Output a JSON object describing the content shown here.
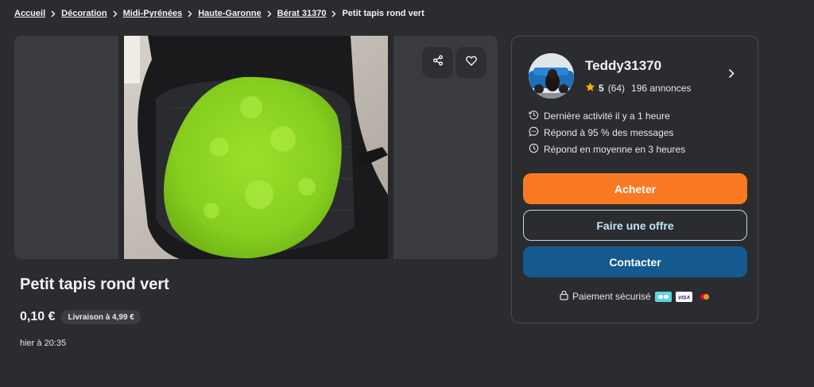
{
  "breadcrumb": {
    "items": [
      "Accueil",
      "Décoration",
      "Midi-Pyrénées",
      "Haute-Garonne",
      "Bérat 31370"
    ],
    "current": "Petit tapis rond vert"
  },
  "listing": {
    "title": "Petit tapis rond vert",
    "price": "0,10 €",
    "shipping": "Livraison à 4,99 €",
    "posted": "hier à 20:35"
  },
  "seller": {
    "name": "Teddy31370",
    "rating": "5",
    "rating_count": "(64)",
    "listings": "196 annonces",
    "last_activity": "Dernière activité il y a 1 heure",
    "response_rate": "Répond à 95 % des messages",
    "response_time": "Répond en moyenne en 3 heures"
  },
  "actions": {
    "buy": "Acheter",
    "offer": "Faire une offre",
    "contact": "Contacter"
  },
  "payment": {
    "label": "Paiement sécurisé"
  },
  "colors": {
    "background": "#2b2c30",
    "buy": "#f97a22",
    "contact": "#14598f",
    "offer_border": "#b9dbe6",
    "star": "#f5b400"
  },
  "icons": [
    "chevron-right-icon",
    "share-icon",
    "heart-icon",
    "star-icon",
    "clock-history-icon",
    "chat-icon",
    "clock-icon",
    "lock-icon",
    "card-brand-icon",
    "visa-icon",
    "mastercard-icon"
  ]
}
